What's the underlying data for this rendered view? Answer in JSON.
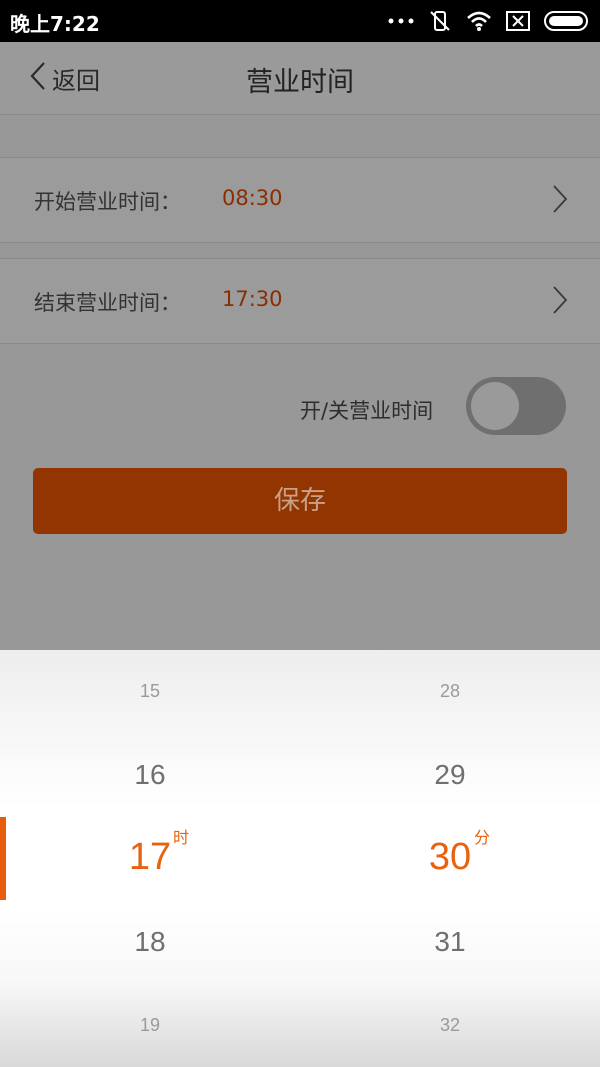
{
  "status_bar": {
    "time": "晚上7:22"
  },
  "nav": {
    "back_label": "返回",
    "title": "营业时间"
  },
  "rows": [
    {
      "label": "开始营业时间：",
      "value": "08:30"
    },
    {
      "label": "结束营业时间：",
      "value": "17:30"
    }
  ],
  "switch": {
    "label": "开/关营业时间",
    "state": "off"
  },
  "save_label": "保存",
  "picker": {
    "hours": {
      "items": [
        "15",
        "16",
        "17",
        "18",
        "19"
      ],
      "selected": "17",
      "unit": "时"
    },
    "minutes": {
      "items": [
        "28",
        "29",
        "30",
        "31",
        "32"
      ],
      "selected": "30",
      "unit": "分"
    }
  },
  "colors": {
    "accent": "#e8620f",
    "save_button": "#923500",
    "value_text": "#8a2e00"
  }
}
